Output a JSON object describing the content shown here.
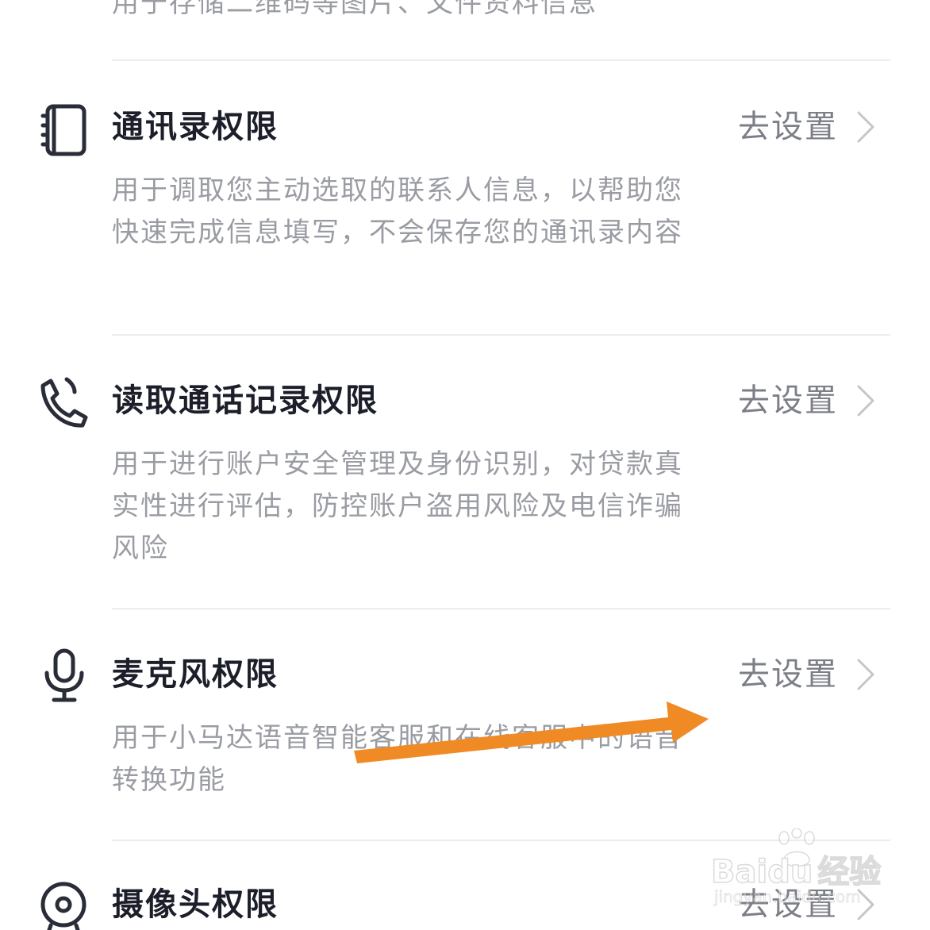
{
  "partial_top_description": "用于存储二维码等图片、文件资料信息",
  "permissions": [
    {
      "title": "通讯录权限",
      "icon": "contacts-book-icon",
      "action_label": "去设置",
      "description": "用于调取您主动选取的联系人信息，以帮助您快速完成信息填写，不会保存您的通讯录内容"
    },
    {
      "title": "读取通话记录权限",
      "icon": "phone-call-icon",
      "action_label": "去设置",
      "description": "用于进行账户安全管理及身份识别，对贷款真实性进行评估，防控账户盗用风险及电信诈骗风险"
    },
    {
      "title": "麦克风权限",
      "icon": "microphone-icon",
      "action_label": "去设置",
      "description": "用于小马达语音智能客服和在线客服中的语音转换功能"
    },
    {
      "title": "摄像头权限",
      "icon": "camera-icon",
      "action_label": "去设置"
    }
  ],
  "annotation": {
    "type": "arrow",
    "color": "#f08a24",
    "points_to": "microphone-permission-action"
  },
  "watermark": {
    "brand": "Baidu",
    "brand_cn": "经验",
    "url": "jingyan.baidu.com"
  },
  "colors": {
    "title": "#1c1f2a",
    "description": "#9a9ca3",
    "action": "#7c7f87",
    "chevron": "#c4c6cb",
    "divider": "#ececee",
    "icon": "#2a2d38"
  }
}
